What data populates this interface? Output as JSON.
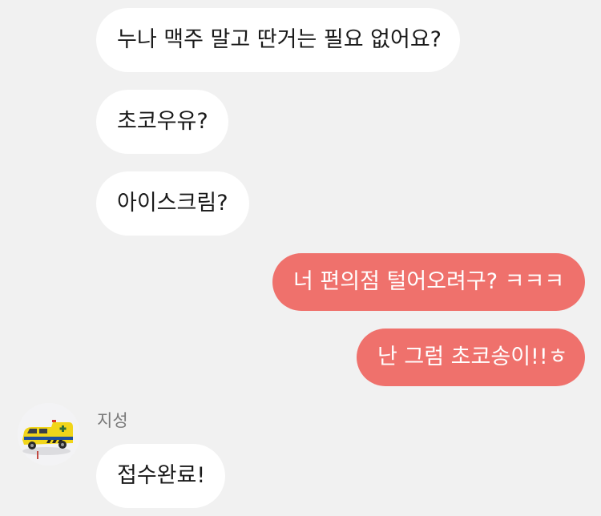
{
  "messages": [
    {
      "id": "b1",
      "side": "received",
      "text": "누나 맥주 말고 딴거는 필요 없어요?"
    },
    {
      "id": "b2",
      "side": "received",
      "text": "초코우유?"
    },
    {
      "id": "b3",
      "side": "received",
      "text": "아이스크림?"
    },
    {
      "id": "m1",
      "side": "sent",
      "text": "너 편의점 털어오려구? ㅋㅋㅋ"
    },
    {
      "id": "m2",
      "side": "sent",
      "text": "난 그럼 초코송이!!ㅎ"
    },
    {
      "id": "b4",
      "side": "received",
      "text": "접수완료!"
    }
  ],
  "sender": {
    "name": "지성",
    "avatar_icon": "toy-ambulance-avatar"
  },
  "colors": {
    "background": "#f1f1f1",
    "received_bubble": "#ffffff",
    "sent_bubble": "#ef716c",
    "sent_text": "#ffffff",
    "received_text": "#1a1a1a"
  }
}
